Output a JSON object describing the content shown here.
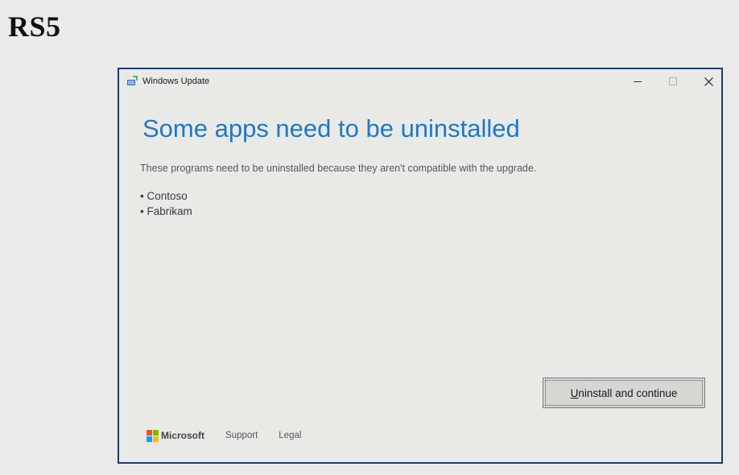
{
  "slide": {
    "title": "RS5"
  },
  "window": {
    "title": "Windows Update",
    "controls": {
      "minimize": "–",
      "maximize": "☐",
      "close": "✕"
    }
  },
  "main": {
    "heading": "Some apps need to be uninstalled",
    "description": "These programs need to be uninstalled because they aren't compatible with the upgrade.",
    "apps": [
      "• Contoso",
      "• Fabrikam"
    ]
  },
  "actions": {
    "primary_mnemonic": "U",
    "primary_rest": "ninstall and continue"
  },
  "footer": {
    "brand": "Microsoft",
    "links": [
      "Support",
      "Legal"
    ]
  },
  "colors": {
    "accent": "#1e78c8",
    "window_border": "#1f3a6b",
    "ms_red": "#f25022",
    "ms_green": "#7fba00",
    "ms_blue": "#00a4ef",
    "ms_yellow": "#ffb900"
  }
}
